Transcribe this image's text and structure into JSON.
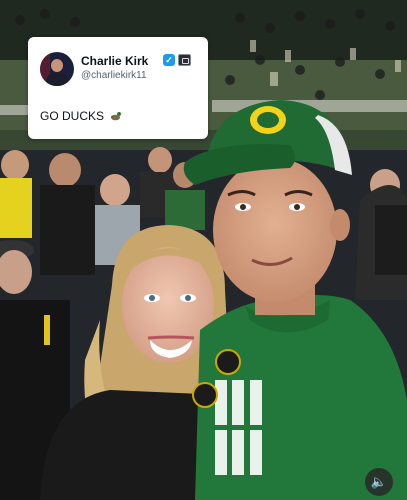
{
  "tweet": {
    "display_name": "Charlie Kirk",
    "handle": "@charliekirk11",
    "text": "GO DUCKS",
    "emoji": "duck-icon",
    "badges": [
      "verified-badge-icon",
      "government-badge-icon"
    ]
  },
  "video_controls": {
    "sound_icon": "speaker-icon"
  },
  "colors": {
    "oregon_green": "#1f6b33",
    "oregon_yellow": "#f5d312",
    "verified_blue": "#1d9bf0"
  }
}
